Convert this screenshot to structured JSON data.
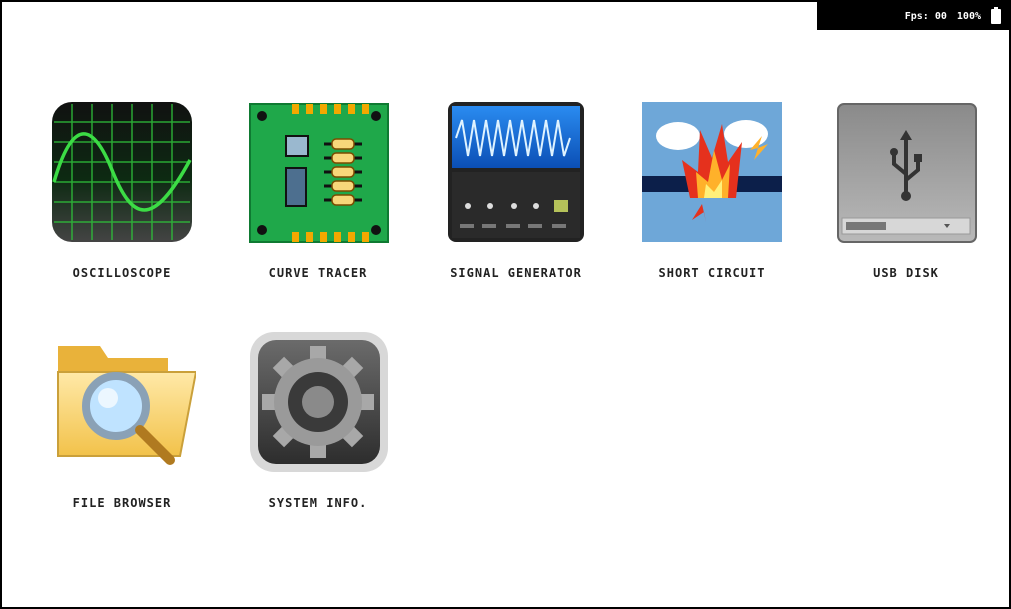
{
  "status": {
    "fps_text": "Fps: 00",
    "battery_text": "100%"
  },
  "apps": [
    {
      "label": "OSCILLOSCOPE",
      "icon": "oscilloscope-icon"
    },
    {
      "label": "CURVE TRACER",
      "icon": "circuit-board-icon"
    },
    {
      "label": "SIGNAL GENERATOR",
      "icon": "signal-generator-icon"
    },
    {
      "label": "SHORT CIRCUIT",
      "icon": "short-circuit-icon"
    },
    {
      "label": "USB DISK",
      "icon": "usb-icon"
    },
    {
      "label": "FILE BROWSER",
      "icon": "folder-search-icon"
    },
    {
      "label": "SYSTEM INFO.",
      "icon": "gear-icon"
    }
  ]
}
